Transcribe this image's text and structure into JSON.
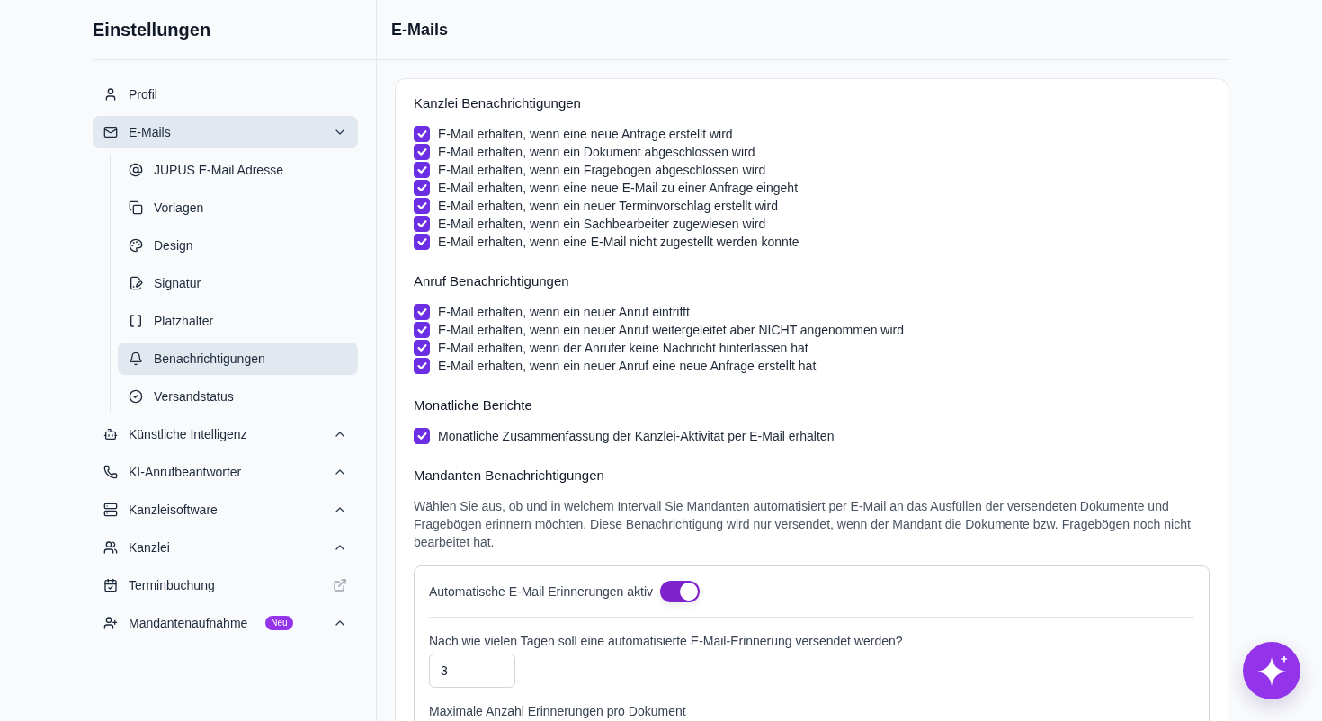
{
  "sidebar": {
    "title": "Einstellungen",
    "items": [
      {
        "label": "Profil",
        "kind": "page",
        "selected": false
      },
      {
        "label": "E-Mails",
        "kind": "group",
        "selected": true,
        "expanded": true,
        "children": [
          {
            "label": "JUPUS E-Mail Adresse",
            "selected": false
          },
          {
            "label": "Vorlagen",
            "selected": false
          },
          {
            "label": "Design",
            "selected": false
          },
          {
            "label": "Signatur",
            "selected": false
          },
          {
            "label": "Platzhalter",
            "selected": false
          },
          {
            "label": "Benachrichtigungen",
            "selected": true
          },
          {
            "label": "Versandstatus",
            "selected": false
          }
        ]
      },
      {
        "label": "Künstliche Intelligenz",
        "kind": "group",
        "selected": false,
        "expanded": false
      },
      {
        "label": "KI-Anrufbeantworter",
        "kind": "group",
        "selected": false,
        "expanded": false
      },
      {
        "label": "Kanzleisoftware",
        "kind": "group",
        "selected": false,
        "expanded": false
      },
      {
        "label": "Kanzlei",
        "kind": "group",
        "selected": false,
        "expanded": false
      },
      {
        "label": "Terminbuchung",
        "kind": "external",
        "selected": false
      },
      {
        "label": "Mandantenaufnahme",
        "kind": "group",
        "selected": false,
        "expanded": false,
        "badge": "Neu"
      }
    ]
  },
  "page": {
    "title": "E-Mails",
    "sections": [
      {
        "kind": "checklist",
        "heading": "Kanzlei Benachrichtigungen",
        "options": [
          {
            "label": "E-Mail erhalten, wenn eine neue Anfrage erstellt wird",
            "checked": true
          },
          {
            "label": "E-Mail erhalten, wenn ein Dokument abgeschlossen wird",
            "checked": true
          },
          {
            "label": "E-Mail erhalten, wenn ein Fragebogen abgeschlossen wird",
            "checked": true
          },
          {
            "label": "E-Mail erhalten, wenn eine neue E-Mail zu einer Anfrage eingeht",
            "checked": true
          },
          {
            "label": "E-Mail erhalten, wenn ein neuer Terminvorschlag erstellt wird",
            "checked": true
          },
          {
            "label": "E-Mail erhalten, wenn ein Sachbearbeiter zugewiesen wird",
            "checked": true
          },
          {
            "label": "E-Mail erhalten, wenn eine E-Mail nicht zugestellt werden konnte",
            "checked": true
          }
        ]
      },
      {
        "kind": "checklist",
        "heading": "Anruf Benachrichtigungen",
        "options": [
          {
            "label": "E-Mail erhalten, wenn ein neuer Anruf eintrifft",
            "checked": true
          },
          {
            "label": "E-Mail erhalten, wenn ein neuer Anruf weitergeleitet aber NICHT angenommen wird",
            "checked": true
          },
          {
            "label": "E-Mail erhalten, wenn der Anrufer keine Nachricht hinterlassen hat",
            "checked": true
          },
          {
            "label": "E-Mail erhalten, wenn ein neuer Anruf eine neue Anfrage erstellt hat",
            "checked": true
          }
        ]
      },
      {
        "kind": "checklist",
        "heading": "Monatliche Berichte",
        "options": [
          {
            "label": "Monatliche Zusammenfassung der Kanzlei-Aktivität per E-Mail erhalten",
            "checked": true
          }
        ]
      },
      {
        "kind": "reminders",
        "heading": "Mandanten Benachrichtigungen",
        "description": "Wählen Sie aus, ob und in welchem Intervall Sie Mandanten automatisiert per E-Mail an das Ausfüllen der versendeten Dokumente und Fragebögen erinnern möchten. Diese Benachrichtigung wird nur versendet, wenn der Mandant die Dokumente bzw. Fragebögen noch nicht bearbeitet hat.",
        "toggle": {
          "label": "Automatische E-Mail Erinnerungen aktiv",
          "on": true
        },
        "fields": [
          {
            "label": "Nach wie vielen Tagen soll eine automatisierte E-Mail-Erinnerung versendet werden?",
            "value": "3"
          },
          {
            "label": "Maximale Anzahl Erinnerungen pro Dokument"
          }
        ]
      }
    ]
  }
}
